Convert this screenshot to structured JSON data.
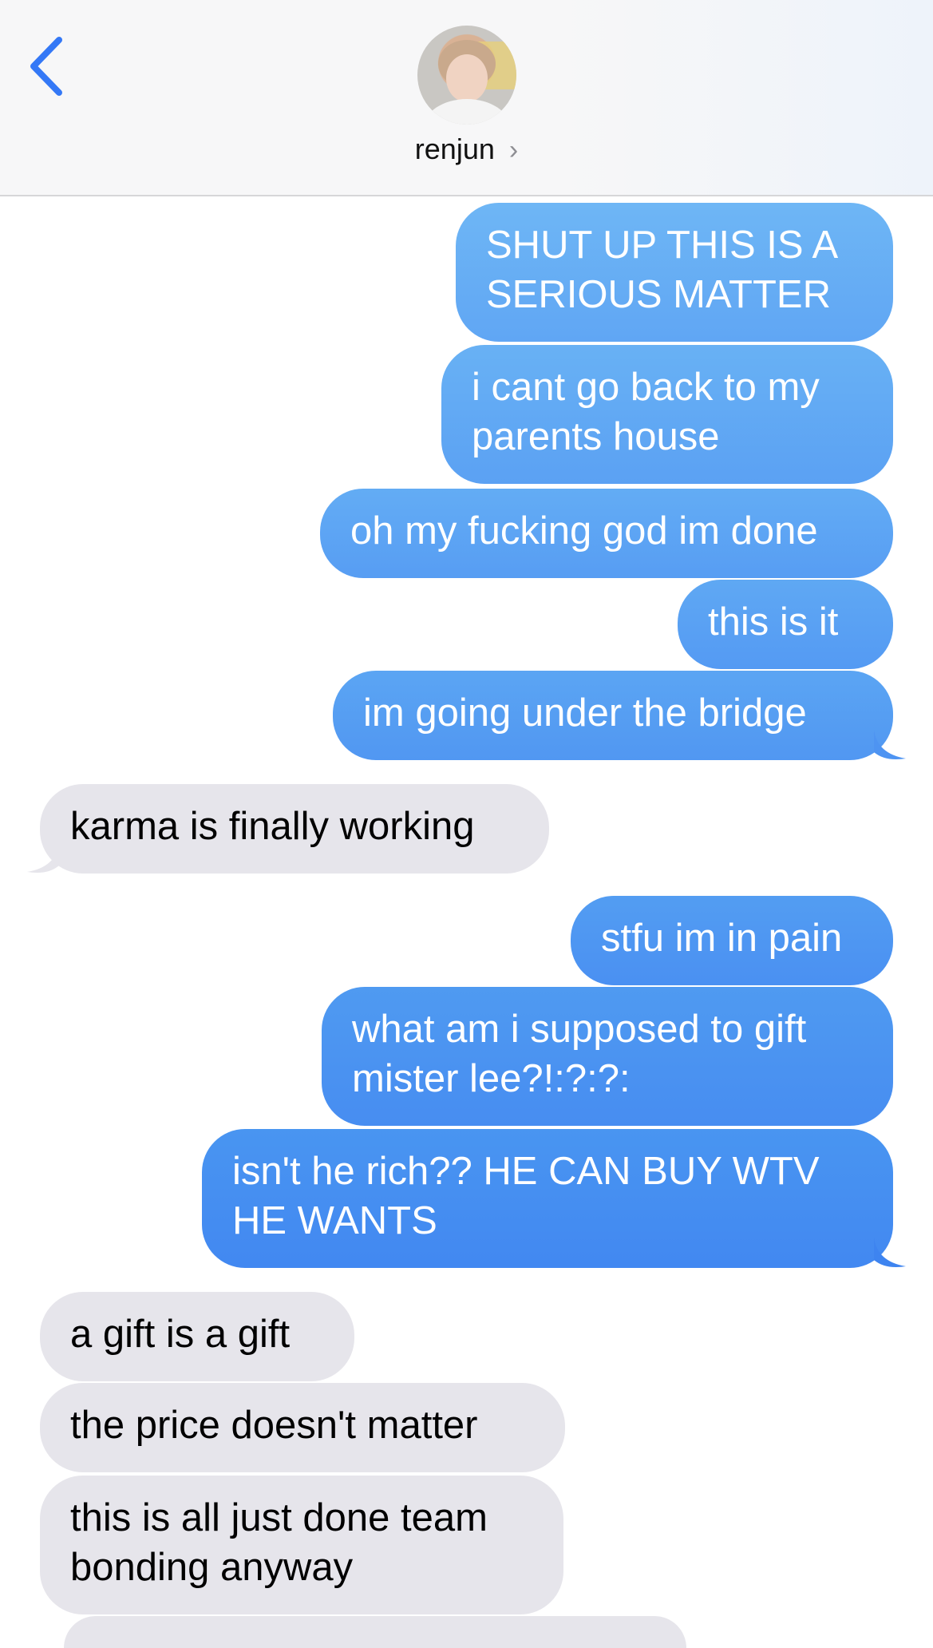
{
  "header": {
    "contact_name": "renjun",
    "back_icon": "chevron-left-icon",
    "chevron_icon": "chevron-right-icon",
    "accent_color": "#3478f6"
  },
  "messages": [
    {
      "side": "out",
      "lines": [
        "SHUT UP THIS IS A",
        "SERIOUS MATTER"
      ]
    },
    {
      "side": "out",
      "lines": [
        "i cant go back to my",
        "parents house"
      ]
    },
    {
      "side": "out",
      "lines": [
        "oh my fucking god im done"
      ]
    },
    {
      "side": "out",
      "lines": [
        "this is it"
      ]
    },
    {
      "side": "out",
      "lines": [
        "im going under the bridge"
      ]
    },
    {
      "side": "in",
      "lines": [
        "karma is finally working"
      ]
    },
    {
      "side": "out",
      "lines": [
        "stfu im in pain"
      ]
    },
    {
      "side": "out",
      "lines": [
        "what am i supposed to gift",
        "mister lee?!:?:?:"
      ]
    },
    {
      "side": "out",
      "lines": [
        "isn't he rich?? HE CAN BUY WTV",
        "HE WANTS"
      ]
    },
    {
      "side": "in",
      "lines": [
        "a gift is a gift"
      ]
    },
    {
      "side": "in",
      "lines": [
        "the price doesn't matter"
      ]
    },
    {
      "side": "in",
      "lines": [
        "this is all just done team",
        "bonding anyway"
      ]
    }
  ]
}
